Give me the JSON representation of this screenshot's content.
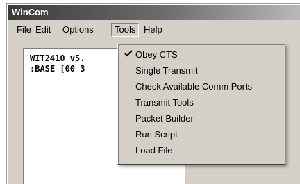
{
  "window": {
    "title": "WinCom"
  },
  "menubar": {
    "items": [
      {
        "label": "File"
      },
      {
        "label": "Edit"
      },
      {
        "label": "Options"
      },
      {
        "label": "Tools"
      },
      {
        "label": "Help"
      }
    ],
    "active": "Tools"
  },
  "terminal": {
    "lines": [
      "WIT2410 v5.",
      ":BASE [00 3"
    ]
  },
  "tools_menu": {
    "items": [
      {
        "label": "Obey CTS",
        "checked": true,
        "icon": "checkmark-icon"
      },
      {
        "label": "Single Transmit",
        "checked": false
      },
      {
        "label": "Check Available Comm Ports",
        "checked": false
      },
      {
        "label": "Transmit Tools",
        "checked": false
      },
      {
        "label": "Packet Builder",
        "checked": false
      },
      {
        "label": "Run Script",
        "checked": false
      },
      {
        "label": "Load File",
        "checked": false
      }
    ]
  }
}
